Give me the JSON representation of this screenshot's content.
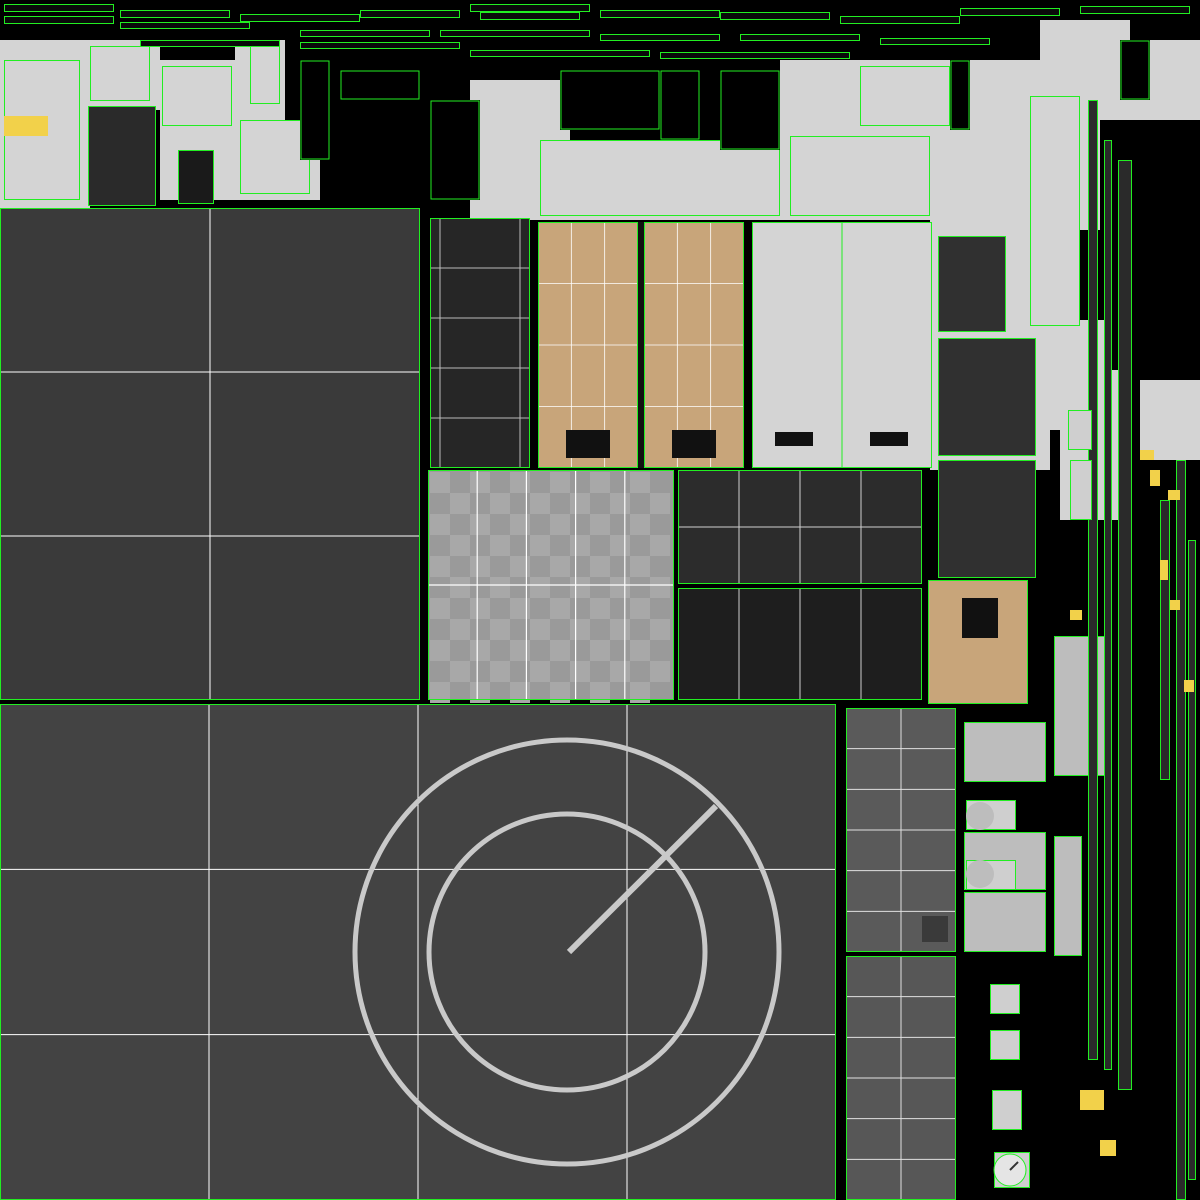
{
  "palette": {
    "background": "#000000",
    "seam": "#22ee22",
    "grid_line": "#ffffff",
    "concrete": "#3a3a3a",
    "concrete_light": "#434343",
    "panel_light": "#d4d4d4",
    "panel_mid": "#bdbdbd",
    "wood": "#c8a57a",
    "tile": "#9a9a9a",
    "dark_panel": "#262626",
    "metal_strip": "#5a5a5a",
    "accent_yellow": "#f2d14a",
    "marking_circle": "#c9c9c9"
  },
  "texture_islands": [
    "upper-left-concrete-slab",
    "helipad-concrete-slab",
    "helipad-circle-marking",
    "wood-floor-left",
    "wood-floor-right",
    "wood-floor-small",
    "light-panel-right",
    "tile-floor",
    "dark-grid-panel",
    "dark-strip-panel",
    "metal-strip-column",
    "trim-strips-top",
    "vertical-rail-right",
    "detail-cluster-right"
  ]
}
